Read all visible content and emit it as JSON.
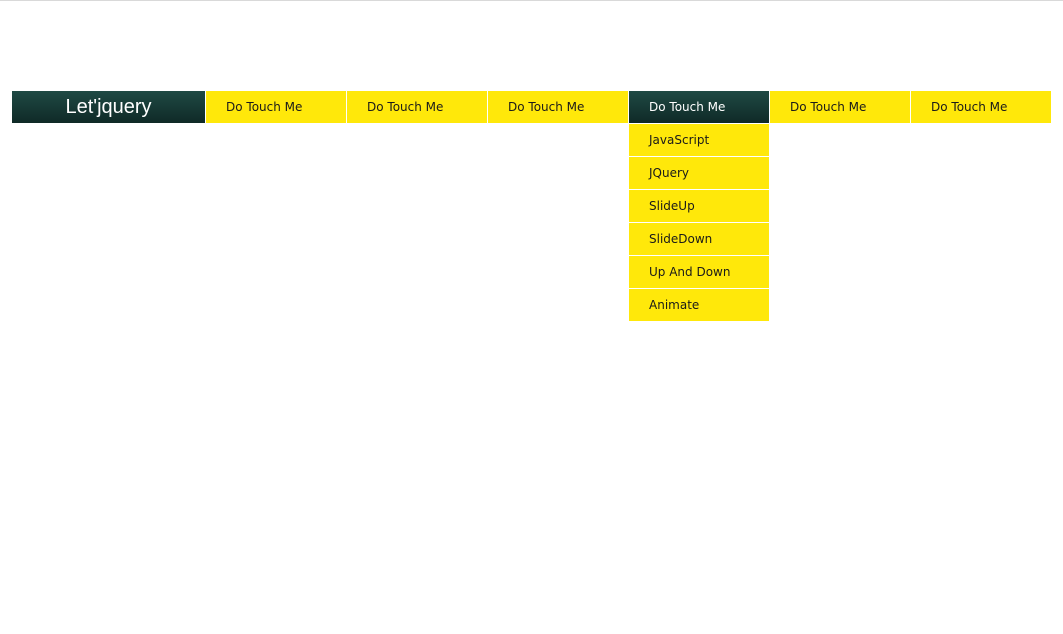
{
  "brand": {
    "title": "Let'jquery"
  },
  "nav": {
    "items": [
      {
        "label": "Do Touch Me"
      },
      {
        "label": "Do Touch Me"
      },
      {
        "label": "Do Touch Me"
      },
      {
        "label": "Do Touch Me",
        "active": true
      },
      {
        "label": "Do Touch Me"
      },
      {
        "label": "Do Touch Me"
      }
    ],
    "dropdown": {
      "items": [
        {
          "label": "JavaScript"
        },
        {
          "label": "JQuery"
        },
        {
          "label": "SlideUp"
        },
        {
          "label": "SlideDown"
        },
        {
          "label": "Up And Down"
        },
        {
          "label": "Animate"
        }
      ]
    }
  },
  "colors": {
    "menu_bg": "#ffe80a",
    "active_bg": "#133833",
    "page_bg": "#ffffff"
  }
}
